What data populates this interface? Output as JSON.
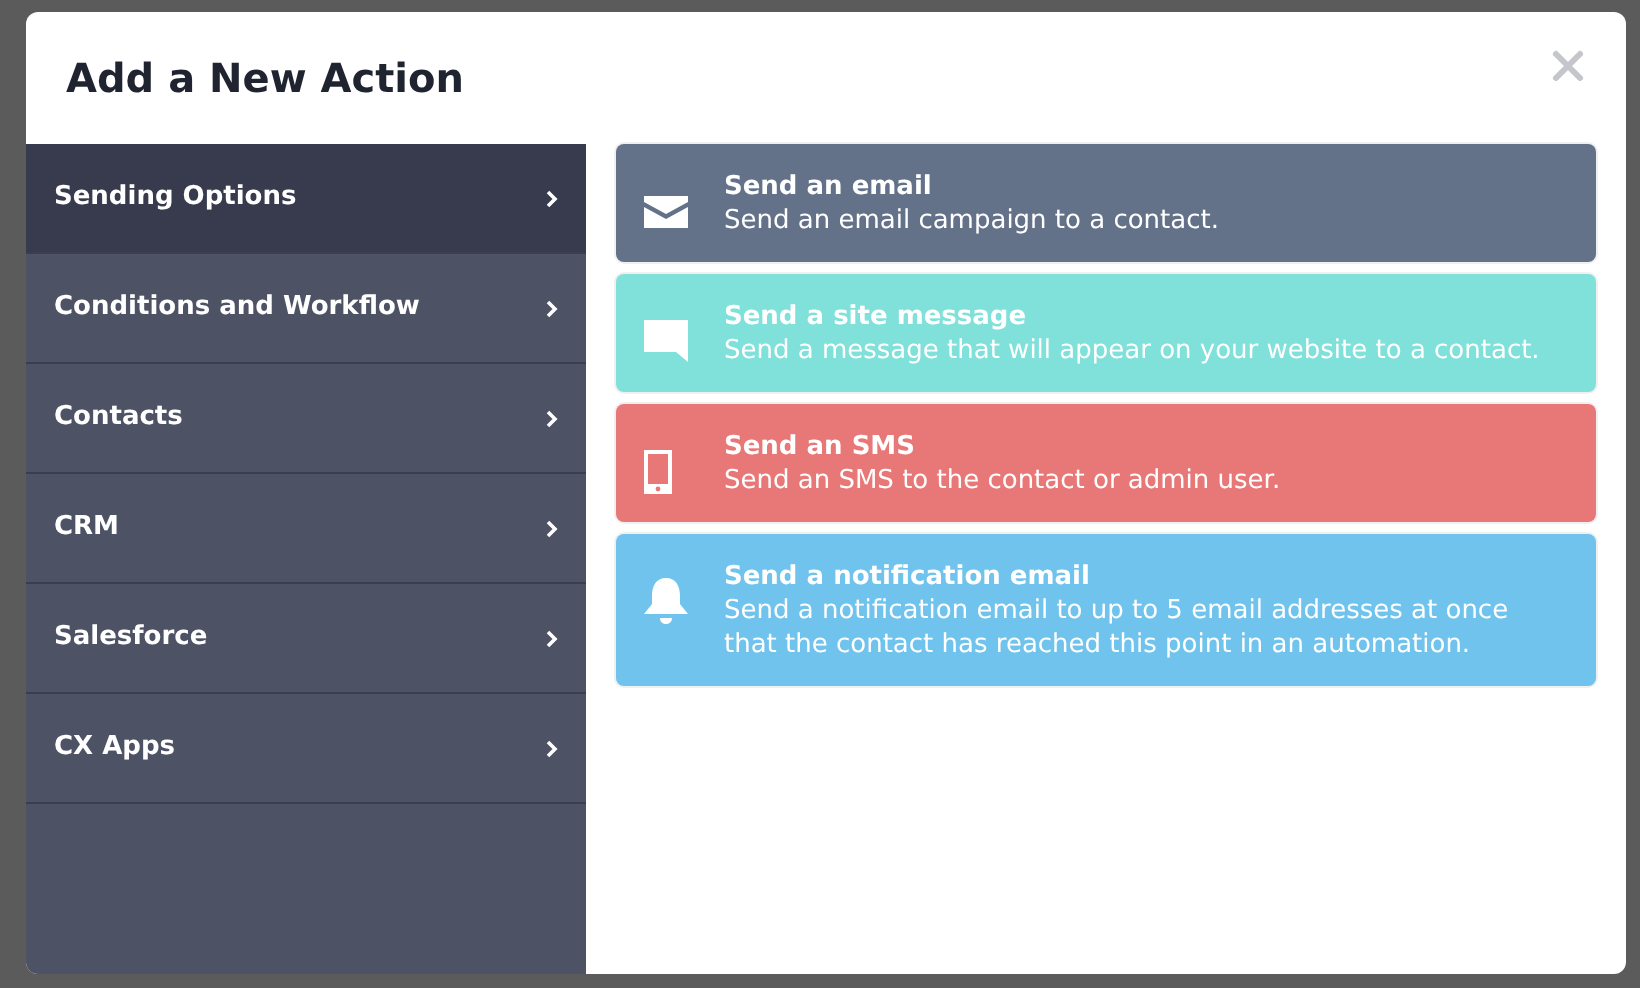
{
  "dialog": {
    "title": "Add a New Action"
  },
  "sidebar": {
    "items": [
      {
        "label": "Sending Options",
        "selected": true
      },
      {
        "label": "Conditions and Workflow",
        "selected": false
      },
      {
        "label": "Contacts",
        "selected": false
      },
      {
        "label": "CRM",
        "selected": false
      },
      {
        "label": "Salesforce",
        "selected": false
      },
      {
        "label": "CX Apps",
        "selected": false
      }
    ]
  },
  "actions": [
    {
      "kind": "email",
      "color": "#637289",
      "title": "Send an email",
      "description": "Send an email campaign to a contact."
    },
    {
      "kind": "message",
      "color": "#80e0da",
      "title": "Send a site message",
      "description": "Send a message that will appear on your website to a contact."
    },
    {
      "kind": "sms",
      "color": "#e87877",
      "title": "Send an SMS",
      "description": "Send an SMS to the contact or admin user."
    },
    {
      "kind": "notification",
      "color": "#6fc3ec",
      "title": "Send a notification email",
      "description": "Send a notification email to up to 5 email addresses at once that the contact has reached this point in an automation."
    }
  ]
}
